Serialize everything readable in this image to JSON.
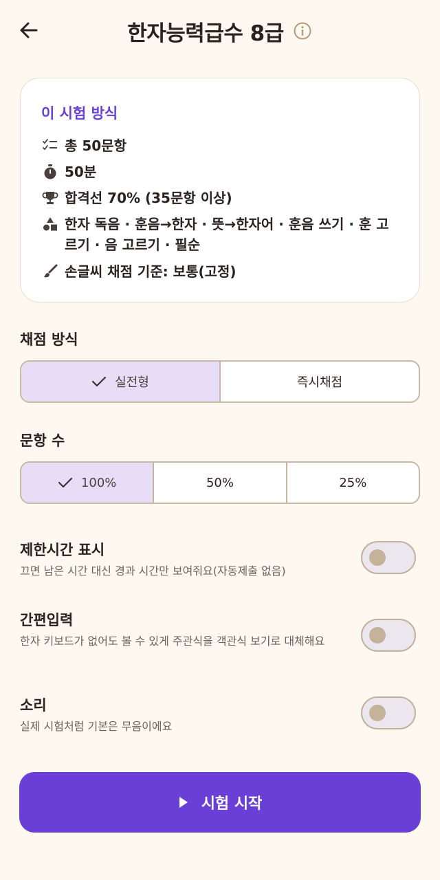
{
  "header": {
    "title": "한자능력급수 8급",
    "back_icon": "arrow-left-icon",
    "info_icon": "info-circle-icon"
  },
  "exam_info": {
    "title": "이 시험 방식",
    "items": [
      {
        "icon": "checklist-icon",
        "text": "총 50문항"
      },
      {
        "icon": "stopwatch-icon",
        "text": "50분"
      },
      {
        "icon": "trophy-icon",
        "text": "합격선 70% (35문항 이상)"
      },
      {
        "icon": "shapes-icon",
        "text": "한자 독음 · 훈음→한자 · 뜻→한자어 · 훈음 쓰기 · 훈 고르기 · 음 고르기 · 필순"
      },
      {
        "icon": "brush-icon",
        "text": "손글씨 채점 기준: 보통(고정)"
      }
    ]
  },
  "grading": {
    "label": "채점 방식",
    "options": [
      "실전형",
      "즉시채점"
    ],
    "selected": "실전형"
  },
  "question_count": {
    "label": "문항 수",
    "options": [
      "100%",
      "50%",
      "25%"
    ],
    "selected": "100%"
  },
  "settings": [
    {
      "title": "제한시간 표시",
      "description": "끄면 남은 시간 대신 경과 시간만 보여줘요(자동제출 없음)",
      "enabled": false
    },
    {
      "title": "간편입력",
      "description": "한자 키보드가 없어도 볼 수 있게 주관식을 객관식 보기로 대체해요",
      "enabled": false
    },
    {
      "title": "소리",
      "description": "실제 시험처럼 기본은 무음이에요",
      "enabled": false
    }
  ],
  "start_button": {
    "label": "시험 시작",
    "icon": "play-icon"
  },
  "colors": {
    "accent": "#6a3fd8",
    "background": "#fdf8f0",
    "selected_bg": "#e7ddf7",
    "border": "#c9b8a4"
  }
}
